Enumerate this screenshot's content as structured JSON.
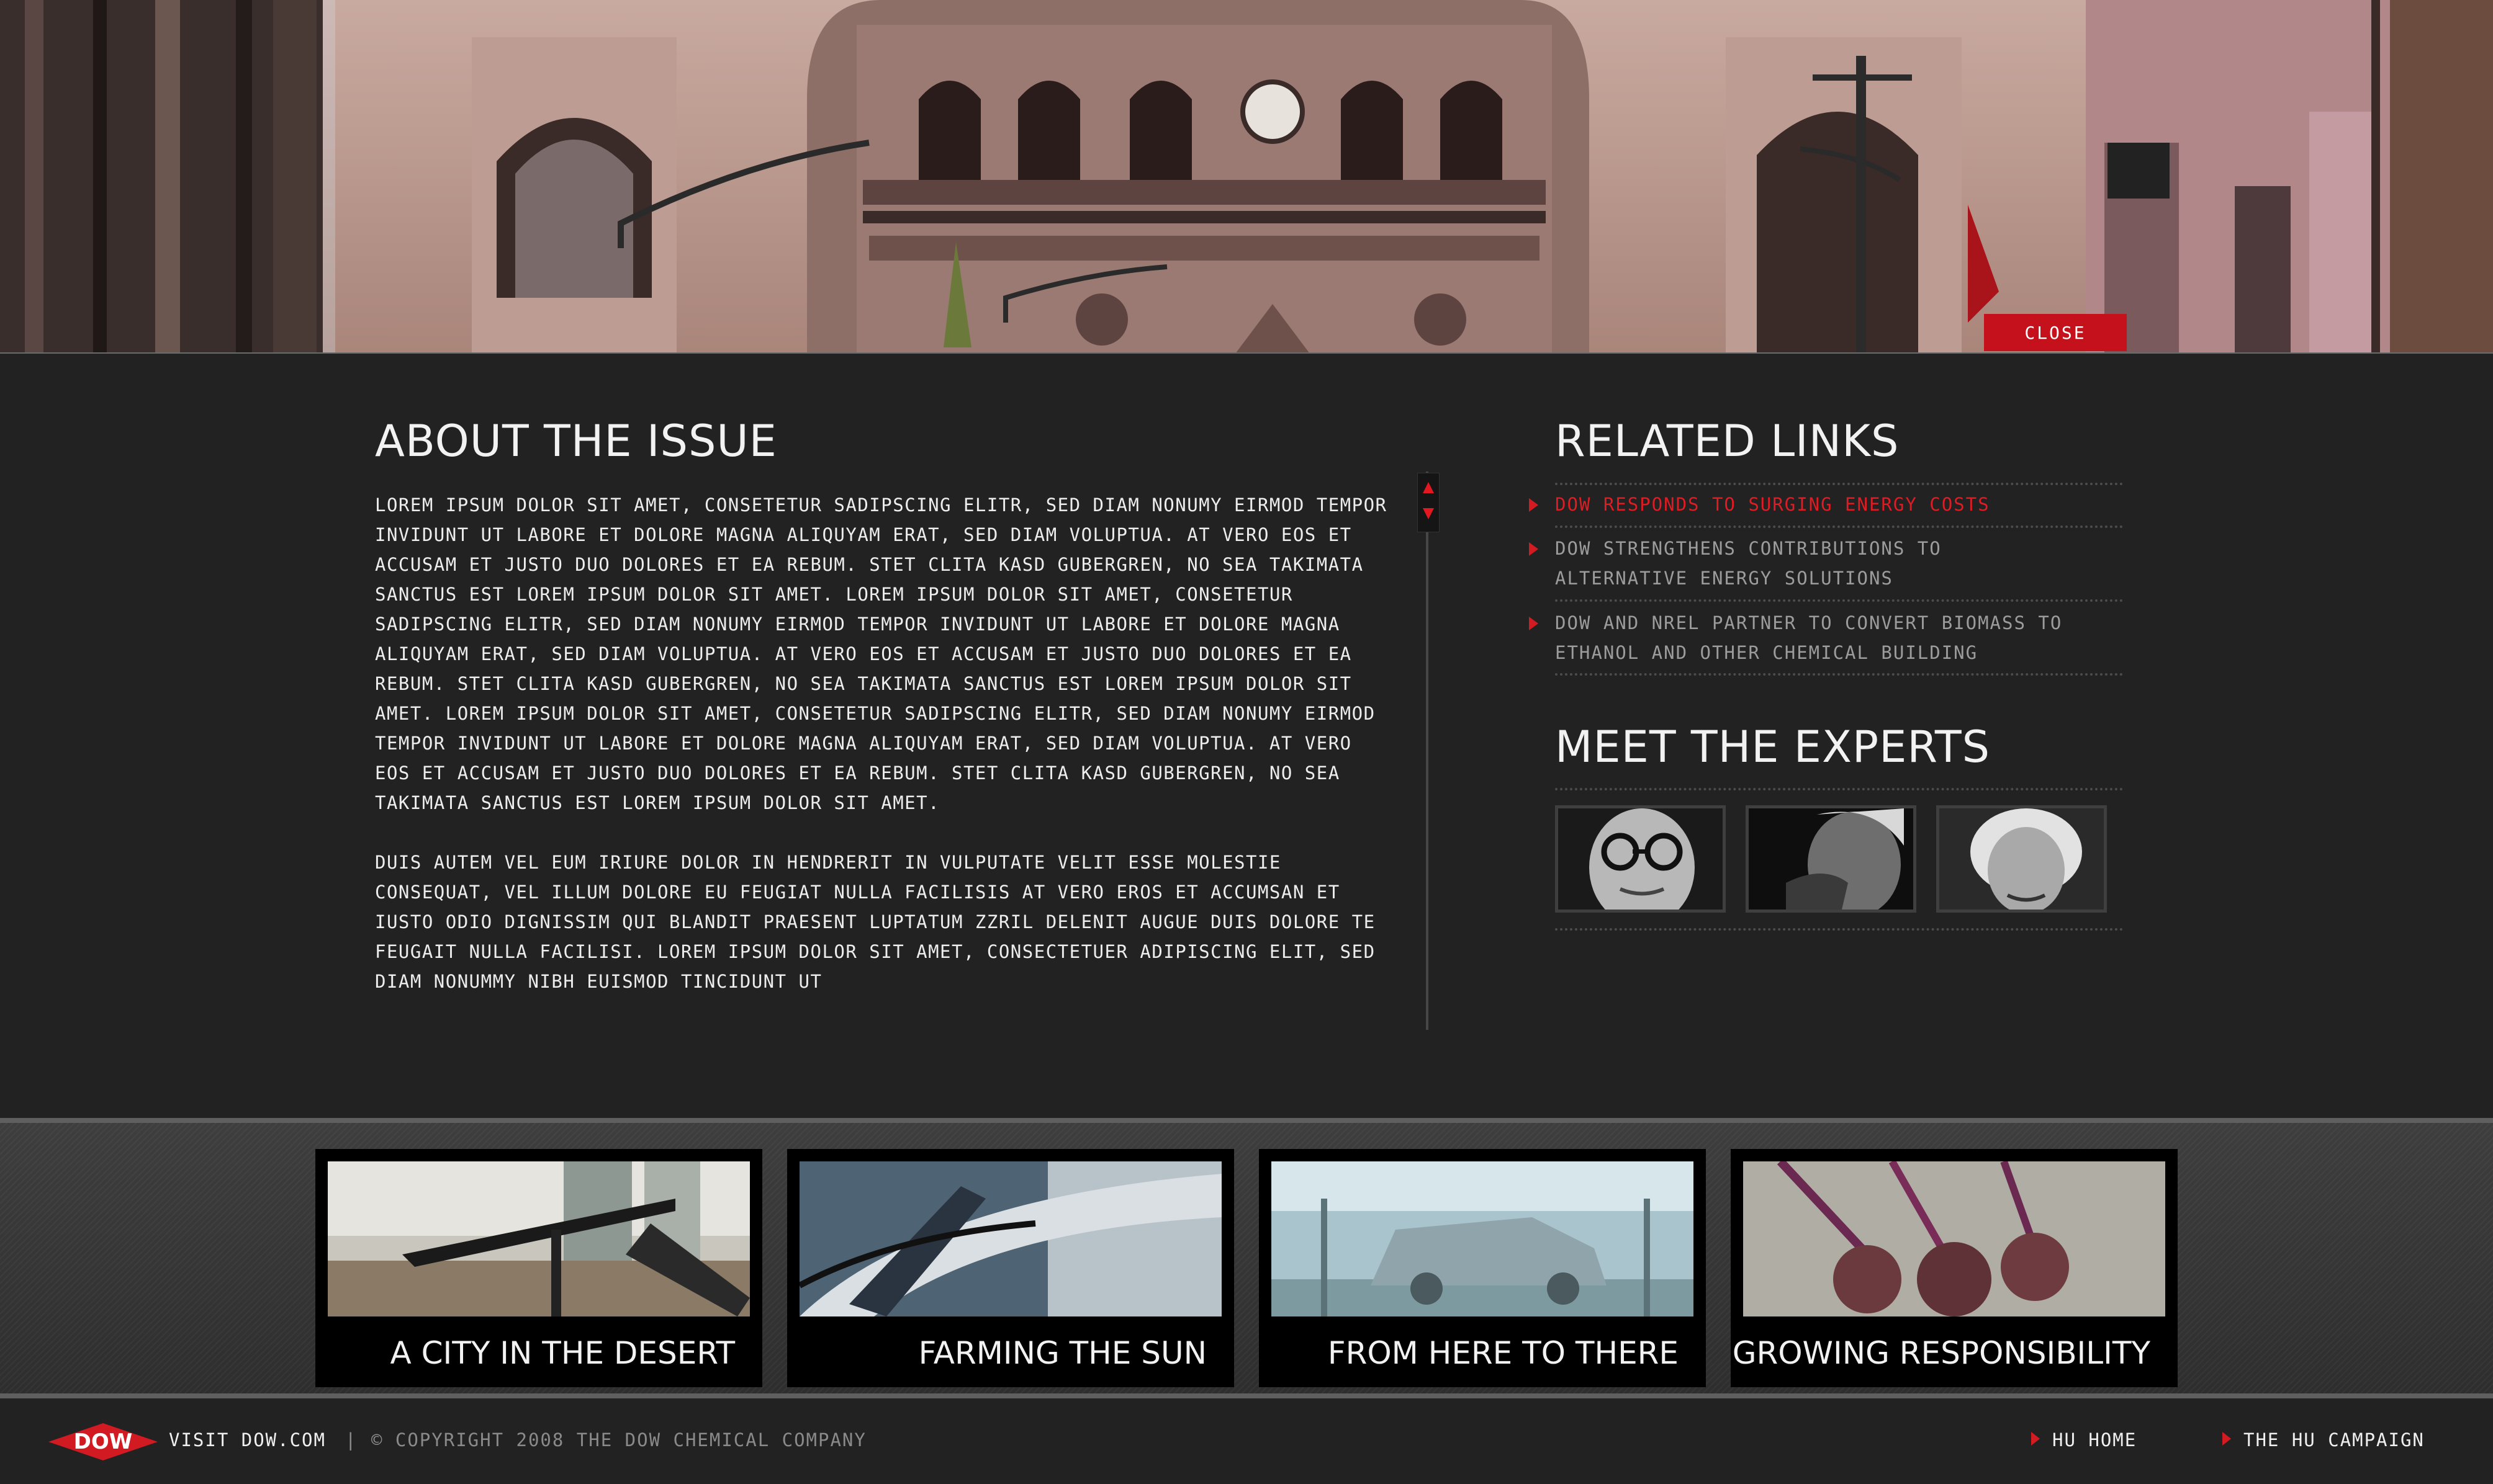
{
  "hero": {
    "close_label": "CLOSE"
  },
  "about": {
    "title": "ABOUT THE ISSUE",
    "paragraphs": [
      "Lorem ipsum dolor sit amet, consetetur sadipscing elitr, sed diam nonumy eirmod tempor invidunt ut labore et dolore magna aliquyam erat, sed diam voluptua. At vero eos et accusam et justo duo dolores et ea rebum. Stet clita kasd gubergren, no sea takimata sanctus est Lorem ipsum dolor sit amet. Lorem ipsum dolor sit amet, consetetur sadipscing elitr,  sed diam nonumy eirmod tempor invidunt ut labore et dolore magna aliquyam erat, sed diam voluptua. At vero eos et accusam et justo duo dolores et ea rebum. Stet clita kasd gubergren, no sea takimata sanctus est Lorem ipsum dolor sit amet. Lorem ipsum dolor sit amet, consetetur sadipscing elitr,  sed diam nonumy eirmod tempor invidunt ut labore et dolore magna aliquyam erat, sed diam voluptua. At vero eos et accusam et justo duo dolores et ea rebum. Stet clita kasd gubergren, no sea takimata sanctus est Lorem ipsum dolor sit amet.",
      "Duis autem vel eum iriure dolor in hendrerit in vulputate velit esse molestie consequat, vel illum dolore eu feugiat nulla facilisis at vero eros et accumsan et iusto odio dignissim qui blandit praesent luptatum zzril delenit augue duis dolore te feugait nulla facilisi. Lorem ipsum dolor sit amet, consectetuer adipiscing elit, sed diam nonummy nibh euismod tincidunt ut"
    ]
  },
  "related": {
    "title": "RELATED LINKS",
    "links": [
      "DOW RESPONDS TO SURGING ENERGY COSTS",
      "DOW STRENGTHENS CONTRIBUTIONS TO ALTERNATIVE ENERGY SOLUTIONS",
      "DOW AND NREL PARTNER TO CONVERT BIOMASS TO ETHANOL AND OTHER CHEMICAL BUILDING"
    ],
    "active_index": 0
  },
  "experts": {
    "title": "MEET THE EXPERTS"
  },
  "features": [
    {
      "caption": "A CITY IN THE DESERT"
    },
    {
      "caption": "FARMING THE SUN"
    },
    {
      "caption": "FROM HERE TO THERE"
    },
    {
      "caption": "GROWING RESPONSIBILITY"
    }
  ],
  "footer": {
    "logo_text": "DOW",
    "visit_label": "VISIT DOW.COM",
    "separator": "|",
    "copyright": "© COPYRIGHT 2008 THE DOW CHEMICAL COMPANY",
    "nav": [
      "HU HOME",
      "THE HU CAMPAIGN"
    ]
  },
  "colors": {
    "accent_red": "#c4111b",
    "background": "#222222",
    "link_gray": "#9c9c9c"
  }
}
